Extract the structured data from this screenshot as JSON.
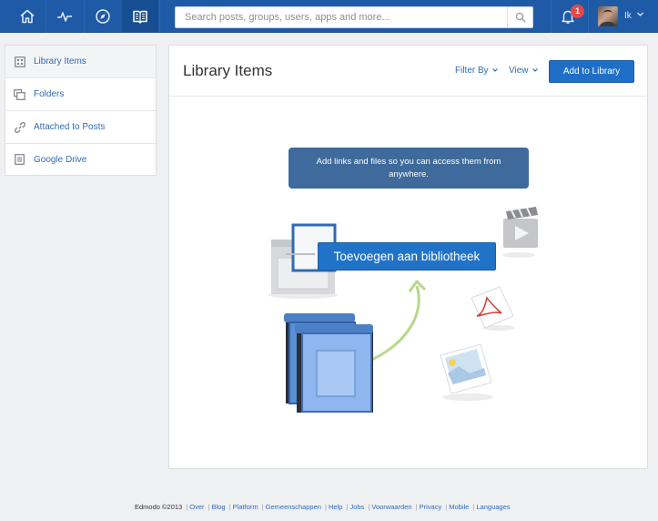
{
  "search": {
    "placeholder": "Search posts, groups, users, apps and more..."
  },
  "notifications": {
    "count": "1"
  },
  "user": {
    "initials": "Ik"
  },
  "nav_icons": [
    "home-icon",
    "activity-icon",
    "compass-icon",
    "library-icon"
  ],
  "sidebar": {
    "items": [
      {
        "label": "Library Items",
        "icon": "grid-icon",
        "active": true
      },
      {
        "label": "Folders",
        "icon": "folders-icon"
      },
      {
        "label": "Attached to Posts",
        "icon": "link-icon"
      },
      {
        "label": "Google Drive",
        "icon": "drive-doc-icon"
      }
    ]
  },
  "main": {
    "title": "Library Items",
    "filter_label": "Filter By",
    "view_label": "View",
    "add_button": "Add to Library",
    "tooltip": "Add links and files so you can access them from anywhere.",
    "overlay_button": "Toevoegen aan bibliotheek"
  },
  "footer": {
    "copyright": "Edmodo ©2013",
    "links": [
      "Over",
      "Blog",
      "Platform",
      "Gemeenschappen",
      "Help",
      "Jobs",
      "Voorwaarden",
      "Privacy",
      "Mobile",
      "Languages"
    ]
  },
  "colors": {
    "topbar": "#1f5aa6",
    "accent": "#1f6fc9",
    "link": "#2f6bb8",
    "badge": "#e64848",
    "tooltip": "#3e6a9c"
  }
}
